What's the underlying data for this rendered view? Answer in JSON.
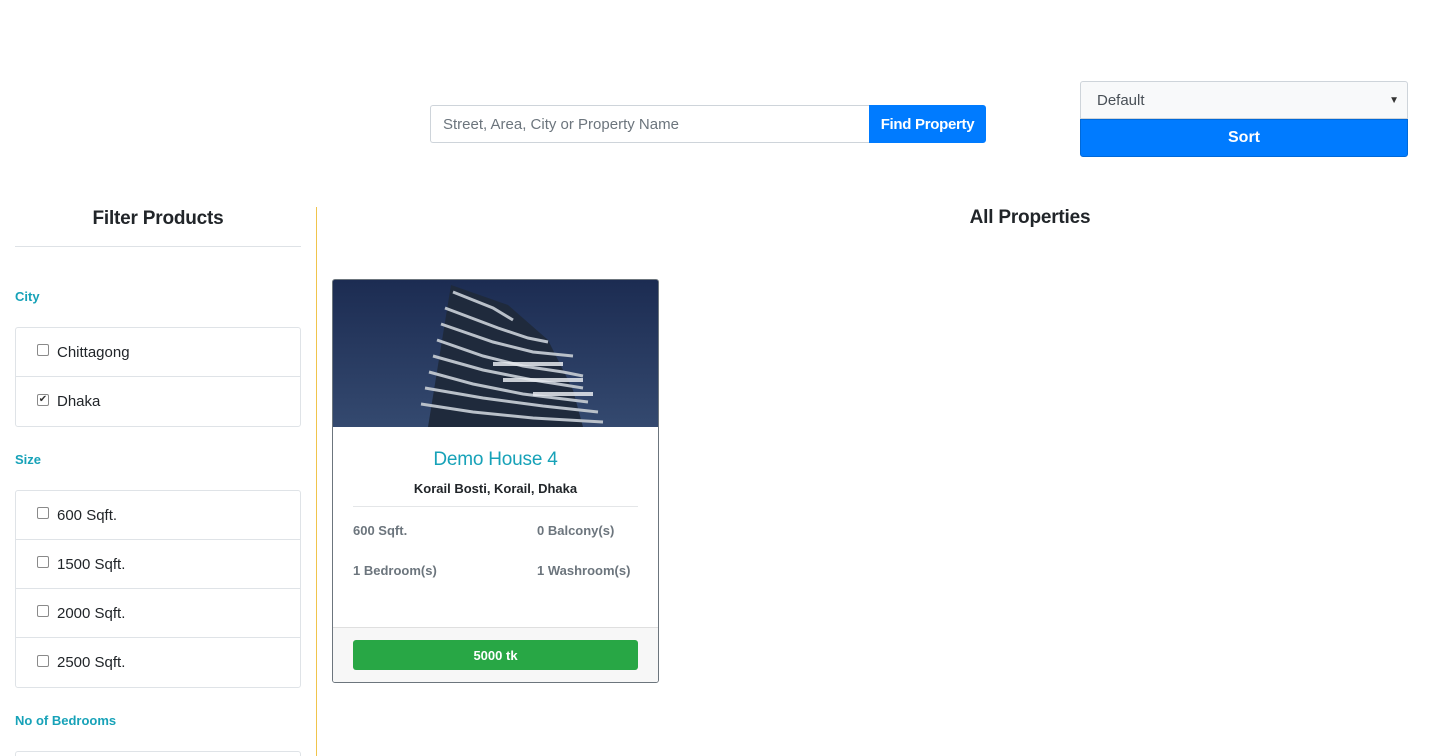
{
  "search": {
    "placeholder": "Street, Area, City or Property Name",
    "button_label": "Find Property"
  },
  "sort": {
    "selected": "Default",
    "button_label": "Sort"
  },
  "sidebar": {
    "title": "Filter Products",
    "city": {
      "heading": "City",
      "options": [
        {
          "label": "Chittagong",
          "checked": false
        },
        {
          "label": "Dhaka",
          "checked": true
        }
      ]
    },
    "size": {
      "heading": "Size",
      "options": [
        {
          "label": "600 Sqft.",
          "checked": false
        },
        {
          "label": "1500 Sqft.",
          "checked": false
        },
        {
          "label": "2000 Sqft.",
          "checked": false
        },
        {
          "label": "2500 Sqft.",
          "checked": false
        }
      ]
    },
    "bedrooms": {
      "heading": "No of Bedrooms"
    }
  },
  "main": {
    "title": "All Properties"
  },
  "property": {
    "title": "Demo House 4",
    "address": "Korail Bosti, Korail, Dhaka",
    "size": "600 Sqft.",
    "balcony": "0 Balcony(s)",
    "bedrooms": "1 Bedroom(s)",
    "washrooms": "1 Washroom(s)",
    "price": "5000 tk"
  },
  "colors": {
    "primary": "#007bff",
    "info": "#17a2b8",
    "success": "#28a745",
    "divider": "#f0c44c"
  }
}
